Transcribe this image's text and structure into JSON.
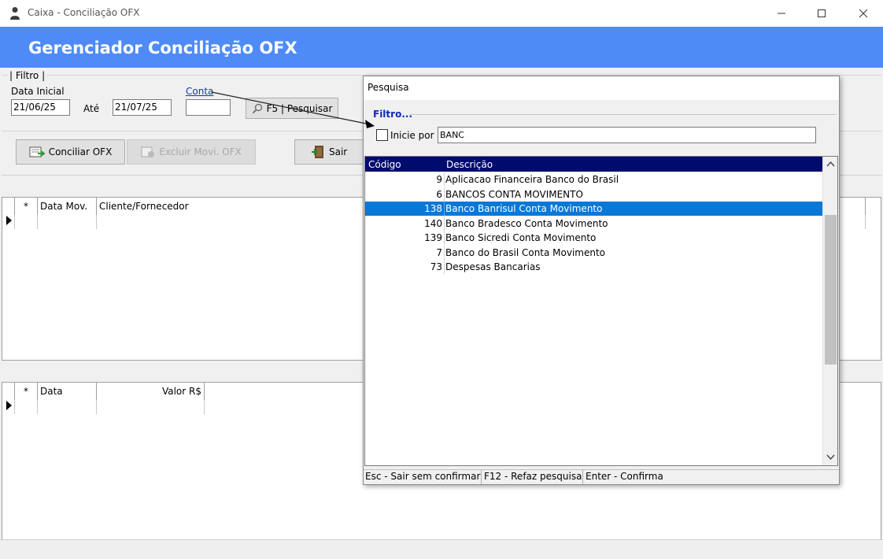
{
  "window": {
    "title": "Caixa - Conciliação OFX",
    "header_title": "Gerenciador Conciliação OFX"
  },
  "filter": {
    "legend": "| Filtro |",
    "data_inicial_label": "Data Inicial",
    "data_inicial_value": "21/06/25",
    "ate_label": "Até",
    "data_final_value": "21/07/25",
    "conta_label": "Conta",
    "conta_value": "",
    "pesquisar_label": "F5 | Pesquisar"
  },
  "toolbar": {
    "conciliar_label": "Conciliar OFX",
    "excluir_label": "Excluir Movi. OFX",
    "sair_label": "Sair"
  },
  "grid_movimentos": {
    "columns": [
      "*",
      "Data Mov.",
      "Cliente/Fornecedor"
    ]
  },
  "grid_ofx": {
    "columns": [
      "*",
      "Data",
      "Valor R$"
    ]
  },
  "search_dialog": {
    "title": "Pesquisa",
    "filter_label": "Filtro...",
    "inicie_por_label": "Inicie por",
    "inicie_por_checked": false,
    "search_value": "BANC",
    "columns": [
      "Código",
      "Descrição"
    ],
    "rows": [
      {
        "codigo": "9",
        "descricao": "Aplicacao Financeira Banco do Brasil",
        "selected": false
      },
      {
        "codigo": "6",
        "descricao": "BANCOS CONTA MOVIMENTO",
        "selected": false
      },
      {
        "codigo": "138",
        "descricao": "Banco Banrisul Conta Movimento",
        "selected": true
      },
      {
        "codigo": "140",
        "descricao": "Banco Bradesco Conta Movimento",
        "selected": false
      },
      {
        "codigo": "139",
        "descricao": "Banco Sicredi Conta Movimento",
        "selected": false
      },
      {
        "codigo": "7",
        "descricao": "Banco do Brasil Conta Movimento",
        "selected": false
      },
      {
        "codigo": "73",
        "descricao": "Despesas Bancarias",
        "selected": false
      }
    ],
    "status": {
      "esc": "Esc - Sair sem confirmar",
      "f12": "F12 - Refaz pesquisa",
      "enter": "Enter - Confirma"
    }
  },
  "colors": {
    "header_bg": "#4f8bf7",
    "list_header_bg": "#000b6e",
    "selection_bg": "#0a78d7",
    "link": "#0a3bb5"
  }
}
